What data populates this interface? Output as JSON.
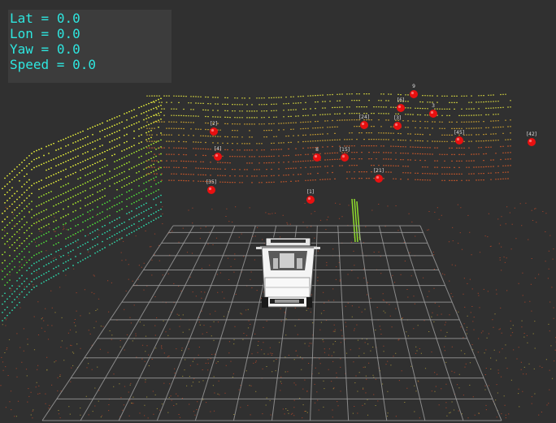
{
  "telemetry": {
    "lines": [
      {
        "label": "Lat",
        "value": "0.0"
      },
      {
        "label": "Lon",
        "value": "0.0"
      },
      {
        "label": "Yaw",
        "value": "0.0"
      },
      {
        "label": "Speed",
        "value": "0.0"
      }
    ]
  },
  "colors": {
    "background": "#303030",
    "grid": "#a0a0a0",
    "telemetry_text": "#2ee6df",
    "object_marker": "#e81010",
    "label_text": "#dddddd"
  },
  "detected_objects": [
    {
      "id": "[2]"
    },
    {
      "id": "[4]"
    },
    {
      "id": "[35]"
    },
    {
      "id": "[1]"
    },
    {
      "id": "8"
    },
    {
      "id": "[15]"
    },
    {
      "id": "[21]"
    },
    {
      "id": "[24]"
    },
    {
      "id": "[3]"
    },
    {
      "id": "[6]"
    },
    {
      "id": "3"
    },
    {
      "id": "9"
    },
    {
      "id": "[45]"
    },
    {
      "id": "[42]"
    }
  ]
}
